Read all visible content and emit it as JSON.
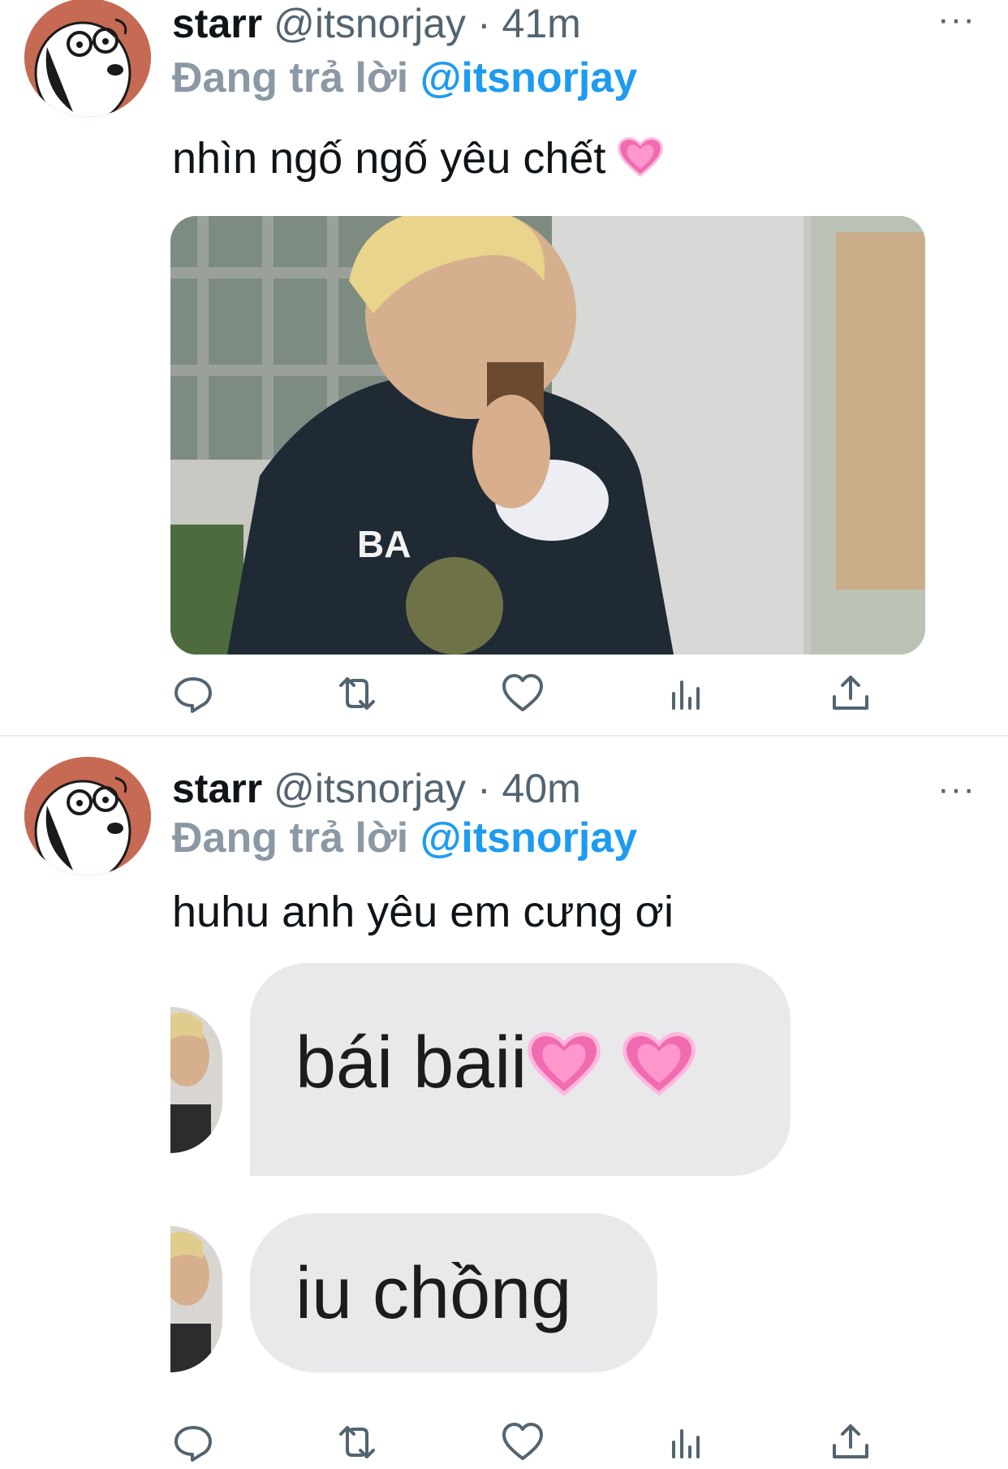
{
  "tweets": [
    {
      "name": "starr",
      "handle": "@itsnorjay",
      "separator": "·",
      "time": "41m",
      "reply_label": "Đang trả lời",
      "reply_to": "@itsnorjay",
      "text": "nhìn ngố ngố yêu chết",
      "emoji": "pink-heart",
      "more": "···"
    },
    {
      "name": "starr",
      "handle": "@itsnorjay",
      "separator": "·",
      "time": "40m",
      "reply_label": "Đang trả lời",
      "reply_to": "@itsnorjay",
      "text": "huhu anh yêu em cưng ơi",
      "more": "···",
      "messages": [
        {
          "text": "bái baii",
          "emojis": [
            "pink-heart",
            "pink-heart"
          ]
        },
        {
          "text": "iu chồng"
        }
      ]
    }
  ],
  "action_icons": [
    "reply-icon",
    "retweet-icon",
    "like-icon",
    "analytics-icon",
    "share-icon"
  ],
  "colors": {
    "link": "#1d9bf0",
    "muted": "#536471",
    "reply_label": "#8b98a5",
    "bubble": "#e9e9eb",
    "avatar_bg": "#c66a54",
    "heart": "#f06bb0"
  }
}
